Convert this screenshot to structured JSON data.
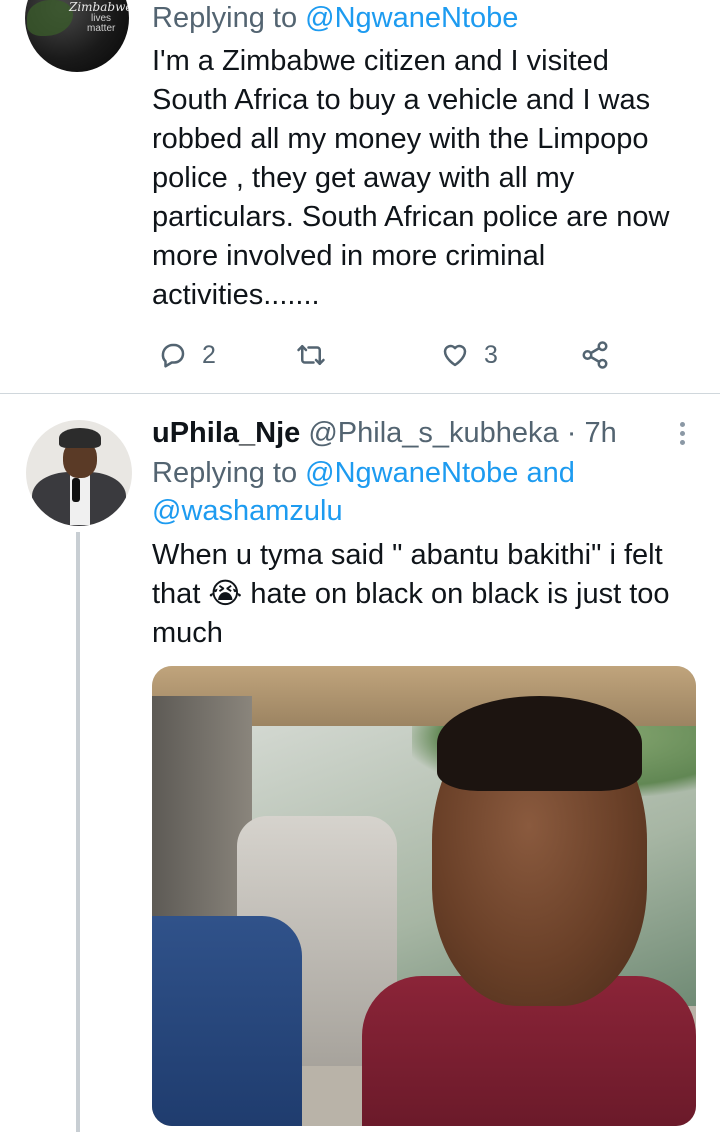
{
  "tweet1": {
    "avatar": {
      "line1": "Zimbabwean",
      "line2": "lives",
      "line3": "matter"
    },
    "replying_prefix": "Replying to ",
    "replying_handle": "@NgwaneNtobe",
    "text_lines": [
      "I'm a Zimbabwe citizen and I visited",
      "South Africa to buy a vehicle and I was",
      "robbed all my money with the Limpopo",
      "police , they get away with all my",
      "particulars. South African police are now",
      "more involved in more criminal",
      "activities......."
    ],
    "actions": {
      "replies": "2",
      "retweets": "",
      "likes": "3"
    }
  },
  "tweet2": {
    "name": "uPhila_Nje",
    "handle": "@Phila_s_kubheka",
    "time": "· 7h",
    "replying_prefix": "Replying to ",
    "replying_handle1": "@NgwaneNtobe",
    "replying_and": " and",
    "replying_handle2": "@washamzulu",
    "text_lines": [
      "When u tyma said \" abantu bakithi\" i felt",
      "that 😭 hate on black on black is just too",
      "much"
    ]
  },
  "colors": {
    "link": "#1d9bf0",
    "secondary_text": "#536471",
    "primary_text": "#0f1419",
    "divider": "#d0d7dc"
  },
  "icons": [
    "reply-icon",
    "retweet-icon",
    "like-icon",
    "share-icon",
    "more-icon"
  ]
}
